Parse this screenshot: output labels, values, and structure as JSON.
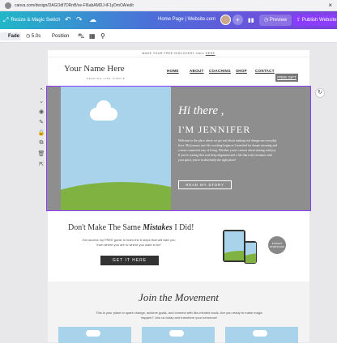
{
  "browser": {
    "url": "canva.com/design/DAGOdl7DRnB/xe-Fl6abAMDJ-tF1yDmOA/edit"
  },
  "topbar": {
    "resize_label": "Resize & Magic Switch",
    "doc_title": "Home Page | Website.com",
    "plus": "+",
    "preview_label": "Preview",
    "publish_label": "Publish Website"
  },
  "toolbar": {
    "fade": "Fade",
    "duration": "5.0s",
    "position": "Position"
  },
  "site": {
    "announcement": "MAKE YOUR FREE DISCOVERY CALL",
    "announcement_link": "HERE",
    "name": "Your Name Here",
    "tagline": "KEEPING LIFE SIMPLE",
    "nav": [
      "HOME",
      "ABOUT",
      "COACHING",
      "SHOP",
      "CONTACT"
    ],
    "free_gift": "FREE GIFT"
  },
  "hero": {
    "greeting": "Hi there ,",
    "name": "I'M JENNIFER",
    "body": "Welcome to the place where we get real about making real change our everyday lives. My journey into life coaching began as I searched for deeper meaning and a more connected way of living. Whether you're curious about sharing with joy. If you're craving that soul-deep alignment and a life that truly resonates with your spirit, you're in absolutely the right place!",
    "button": "READ MY STORY"
  },
  "mistakes": {
    "heading_pre": "Don't Make The Same ",
    "heading_em": "Mistakes",
    "heading_post": " I Did!",
    "body": "Get access my FREE guide to learn the 6 steps that will take you from where you are to where you want to be!",
    "button": "GET IT HERE",
    "badge": "INSTANT DOWNLOAD"
  },
  "movement": {
    "heading": "Join the Movement",
    "body": "This is your place to spark change, achieve goals, and connect with like-minded souls. Are you ready to make magic happen? Join us today and transform your tomorrow!"
  }
}
